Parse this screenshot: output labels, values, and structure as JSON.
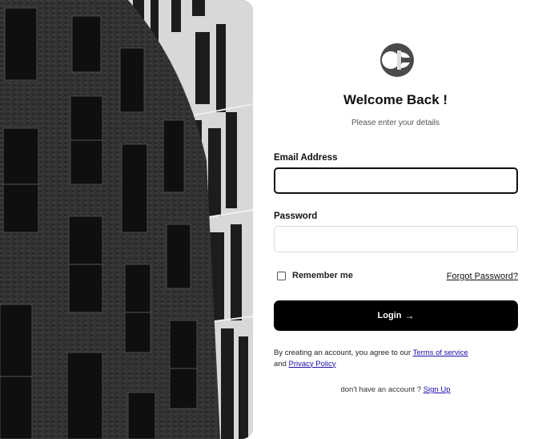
{
  "login": {
    "title": "Welcome Back !",
    "subtitle": "Please enter your details",
    "email_label": "Email Address",
    "email_value": "",
    "password_label": "Password",
    "password_value": "",
    "remember_label": "Remember me",
    "forgot_label": "Forgot Password?",
    "login_label": "Login",
    "login_icon": "→",
    "terms_prefix": "By creating an account, you agree to our",
    "terms_link": "Terms of service",
    "terms_and": "and",
    "privacy_link": "Privacy Policy",
    "signup_prefix": "don't have an account ?",
    "signup_link": "Sign Up"
  },
  "icons": {
    "logo": "c-logo",
    "login_arrow": "arrow-right-icon"
  },
  "colors": {
    "primary": "#000000",
    "link": "#1a0dab",
    "background": "#ffffff"
  }
}
